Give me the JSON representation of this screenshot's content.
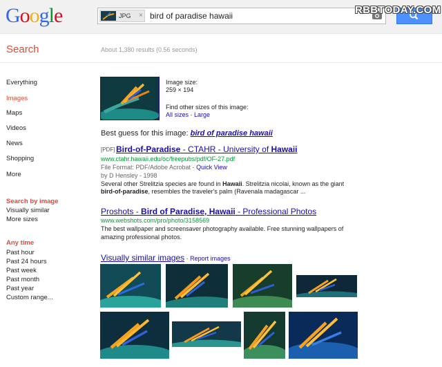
{
  "header": {
    "logo": [
      "G",
      "o",
      "o",
      "g",
      "l",
      "e"
    ],
    "chip_label": "JPG",
    "chip_close": "×",
    "query": "bird of paradise hawaii",
    "watermark": "RBBTODAY.COM"
  },
  "search_label": "Search",
  "stats": "About 1,380 results (0.56 seconds)",
  "sidebar": {
    "items": [
      "Everything",
      "Images",
      "Maps",
      "Videos",
      "News",
      "Shopping",
      "More"
    ],
    "search_by_image_heading": "Search by image",
    "search_by_image_items": [
      "Visually similar",
      "More sizes"
    ],
    "time_heading": "Any time",
    "time_items": [
      "Past hour",
      "Past 24 hours",
      "Past week",
      "Past month",
      "Past year",
      "Custom range..."
    ]
  },
  "image_info": {
    "size_label": "Image size:",
    "size_value": "259 × 194",
    "other_sizes_label": "Find other sizes of this image:",
    "all_sizes": "All sizes",
    "separator": " - ",
    "large": "Large"
  },
  "best_guess": {
    "label": "Best guess for this image: ",
    "value": "bird of paradise hawaii"
  },
  "results": [
    {
      "tag": "[PDF]",
      "title_a": "Bird-of-Paradise",
      "title_b": " - CTAHR - University of ",
      "title_c": "Hawaii",
      "url": "www.ctahr.hawaii.edu/oc/freepubs/pdf/OF-27.pdf",
      "format_label": "File Format: PDF/Adobe Acrobat - ",
      "quick_view": "Quick View",
      "author": "by D Hensley - 1998",
      "snippet_1a": "Several other Strelitzia species are found in ",
      "snippet_1b": "Hawaii",
      "snippet_1c": ". Strelitzia nicolai, known as the giant",
      "snippet_2a": "bird-of-paradise",
      "snippet_2b": ", resembles the traveler's palm (Ravenala madagascar ..."
    },
    {
      "title_a": "Proshots - ",
      "title_b": "Bird of Paradise, Hawaii",
      "title_c": " - Professional Photos",
      "url": "www.webshots.com/pro/photo/3158569",
      "snippet_1": "The best wallpaper and screensaver photography available. Free stunning wallpapers of",
      "snippet_2": "amazing professional photos."
    }
  ],
  "similar": {
    "title": "Visually similar images",
    "separator": " - ",
    "report": "Report images"
  },
  "icons": [
    "camera-icon",
    "search-icon"
  ]
}
